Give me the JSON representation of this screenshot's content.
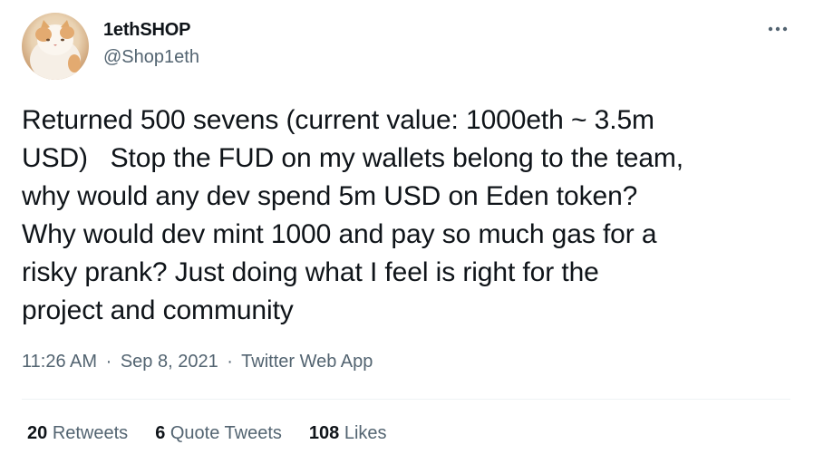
{
  "author": {
    "display_name": "1ethSHOP",
    "handle": "@Shop1eth",
    "avatar_icon": "cat-avatar"
  },
  "menu_icon": "more-dots-icon",
  "tweet": {
    "text": "Returned 500 sevens (current value: 1000eth ~ 3.5m\nUSD)   Stop the FUD on my wallets belong to the team,\nwhy would any dev spend 5m USD on Eden token?\nWhy would dev mint 1000 and pay so much gas for a\nrisky prank? Just doing what I feel is right for the\nproject and community"
  },
  "meta": {
    "time": "11:26 AM",
    "separator": "·",
    "date": "Sep 8, 2021",
    "source": "Twitter Web App"
  },
  "stats": {
    "retweets": {
      "count": "20",
      "label": "Retweets"
    },
    "quote_tweets": {
      "count": "6",
      "label": "Quote Tweets"
    },
    "likes": {
      "count": "108",
      "label": "Likes"
    }
  },
  "colors": {
    "text_primary": "#0f1419",
    "text_secondary": "#536471",
    "divider": "#eff3f4",
    "background": "#ffffff"
  }
}
